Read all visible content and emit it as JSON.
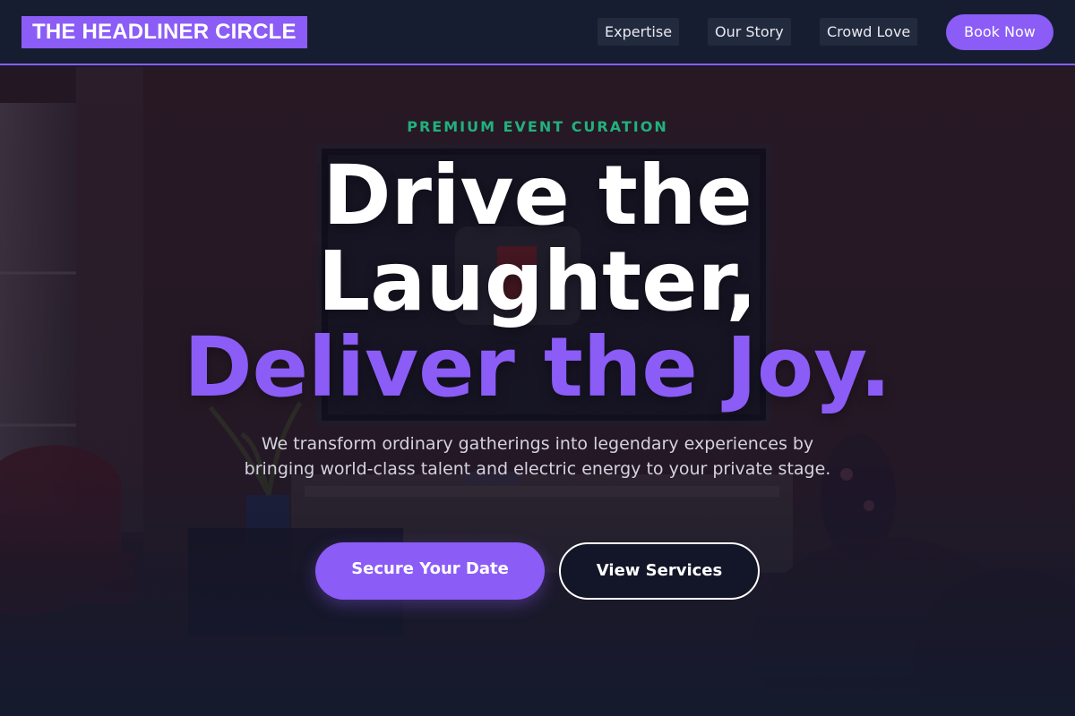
{
  "brand": {
    "logo_text": "THE HEADLINER CIRCLE"
  },
  "nav": {
    "links": [
      "Expertise",
      "Our Story",
      "Crowd Love"
    ],
    "cta_label": "Book Now"
  },
  "hero": {
    "eyebrow": "PREMIUM EVENT CURATION",
    "headline_line1": "Drive the",
    "headline_line2": "Laughter,",
    "headline_accent": "Deliver the Joy.",
    "subcopy": "We transform ordinary gatherings into legendary experiences by bringing world-class talent and electric energy to your private stage.",
    "primary_cta": "Secure Your Date",
    "secondary_cta": "View Services"
  },
  "colors": {
    "accent": "#8b5cf6",
    "eyebrow": "#22b07d",
    "nav_bg": "#171d31",
    "hero_overlay": "#141a2e"
  }
}
